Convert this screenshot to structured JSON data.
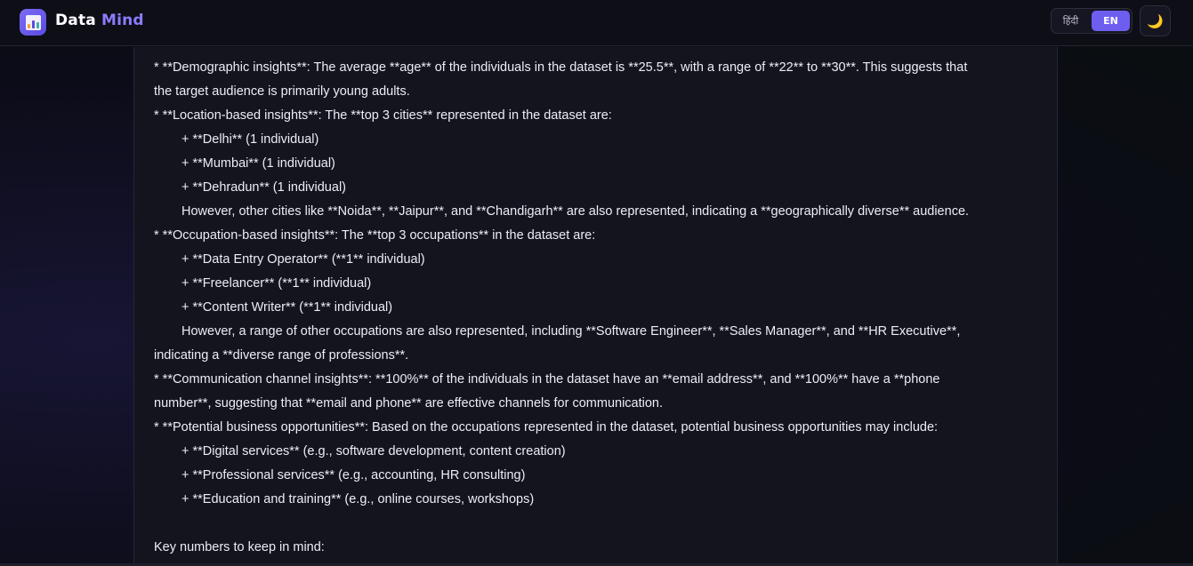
{
  "header": {
    "brand_part1": "Data",
    "brand_part2": "Mind",
    "lang_hindi": "हिंदी",
    "lang_en": "EN",
    "theme_icon": "🌙"
  },
  "response": {
    "lines": [
      "* **Demographic insights**: The average **age** of the individuals in the dataset is **25.5**, with a range of **22** to **30**. This suggests that",
      "the target audience is primarily young adults.",
      "* **Location-based insights**: The **top 3 cities** represented in the dataset are:",
      "+ **Delhi** (1 individual)",
      "+ **Mumbai** (1 individual)",
      "+ **Dehradun** (1 individual)",
      "However, other cities like **Noida**, **Jaipur**, and **Chandigarh** are also represented, indicating a **geographically diverse** audience.",
      "* **Occupation-based insights**: The **top 3 occupations** in the dataset are:",
      "+ **Data Entry Operator** (**1** individual)",
      "+ **Freelancer** (**1** individual)",
      "+ **Content Writer** (**1** individual)",
      "However, a range of other occupations are also represented, including **Software Engineer**, **Sales Manager**, and **HR Executive**,",
      "indicating a **diverse range of professions**.",
      "* **Communication channel insights**: **100%** of the individuals in the dataset have an **email address**, and **100%** have a **phone",
      "number**, suggesting that **email and phone** are effective channels for communication.",
      "* **Potential business opportunities**: Based on the occupations represented in the dataset, potential business opportunities may include:",
      "+ **Digital services** (e.g., software development, content creation)",
      "+ **Professional services** (e.g., accounting, HR consulting)",
      "+ **Education and training** (e.g., online courses, workshops)",
      "",
      "Key numbers to keep in mind:"
    ]
  }
}
